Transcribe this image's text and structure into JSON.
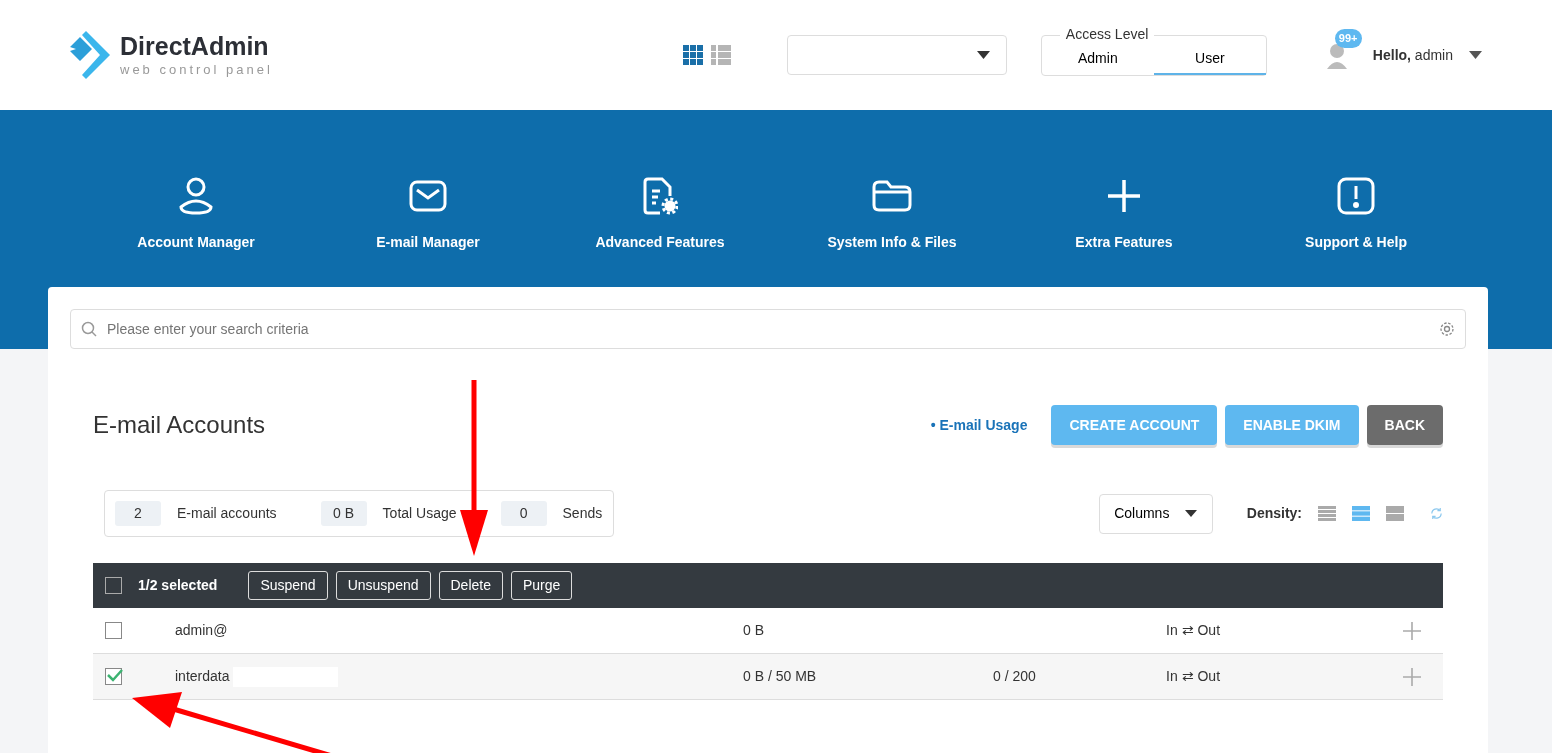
{
  "brand": {
    "name": "DirectAdmin",
    "tagline": "web control panel"
  },
  "header": {
    "views": [
      {
        "selected": true
      },
      {
        "selected": false
      }
    ],
    "access_level": {
      "legend": "Access Level",
      "tabs": [
        {
          "label": "Admin",
          "selected": false
        },
        {
          "label": "User",
          "selected": true
        }
      ]
    },
    "notifications": "99+",
    "greeting": "Hello,",
    "user": "admin"
  },
  "nav": [
    {
      "label": "Account Manager"
    },
    {
      "label": "E-mail Manager"
    },
    {
      "label": "Advanced Features"
    },
    {
      "label": "System Info & Files"
    },
    {
      "label": "Extra Features"
    },
    {
      "label": "Support & Help"
    }
  ],
  "search": {
    "placeholder": "Please enter your search criteria"
  },
  "page_title": "E-mail Accounts",
  "usage_link": "• E-mail Usage",
  "buttons": [
    {
      "label": "CREATE ACCOUNT",
      "kind": "primary"
    },
    {
      "label": "ENABLE DKIM",
      "kind": "primary"
    },
    {
      "label": "BACK",
      "kind": "secondary"
    }
  ],
  "stats": [
    {
      "value": "2",
      "label": "E-mail accounts"
    },
    {
      "value": "0 B",
      "label": "Total Usage"
    },
    {
      "value": "0",
      "label": "Sends"
    }
  ],
  "columns_button": "Columns",
  "density": {
    "label": "Density:",
    "options": [
      {
        "selected": false
      },
      {
        "selected": true
      },
      {
        "selected": false
      }
    ]
  },
  "bulk_bar": {
    "checked": false,
    "selected_count": "1/2 selected",
    "actions": [
      "Suspend",
      "Unsuspend",
      "Delete",
      "Purge"
    ]
  },
  "rows": [
    {
      "checked": false,
      "account": "admin@",
      "redacted": false,
      "usage": "0 B",
      "sends": "",
      "flow": "In ⇄ Out"
    },
    {
      "checked": true,
      "account": "interdata",
      "redacted": true,
      "usage": "0 B / 50 MB",
      "sends": "0 / 200",
      "flow": "In ⇄ Out"
    }
  ]
}
